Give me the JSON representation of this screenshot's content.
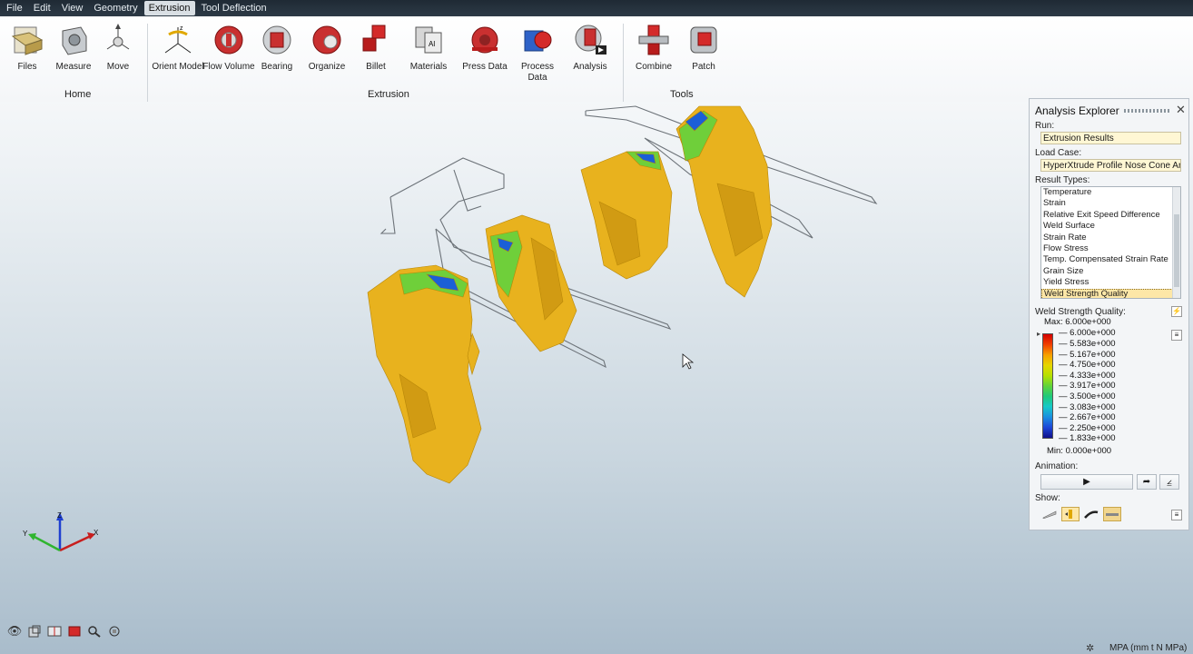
{
  "menu": {
    "items": [
      "File",
      "Edit",
      "View",
      "Geometry",
      "Extrusion",
      "Tool Deflection"
    ],
    "active_index": 4
  },
  "ribbon": {
    "buttons": [
      {
        "label": "Files",
        "icon": "folder-icon"
      },
      {
        "label": "Measure",
        "icon": "measure-icon"
      },
      {
        "label": "Move",
        "icon": "move-icon"
      },
      {
        "label": "Orient Model",
        "icon": "axes-icon"
      },
      {
        "label": "Flow Volume",
        "icon": "flow-volume-icon"
      },
      {
        "label": "Bearing",
        "icon": "bearing-icon"
      },
      {
        "label": "Organize",
        "icon": "organize-icon"
      },
      {
        "label": "Billet",
        "icon": "billet-icon"
      },
      {
        "label": "Materials",
        "icon": "materials-icon"
      },
      {
        "label": "Press Data",
        "icon": "press-icon"
      },
      {
        "label": "Process",
        "label2": "Data",
        "icon": "process-data-icon"
      },
      {
        "label": "Analysis",
        "icon": "analysis-icon"
      },
      {
        "label": "Combine",
        "icon": "combine-icon"
      },
      {
        "label": "Patch",
        "icon": "patch-icon"
      }
    ],
    "groups": [
      "Home",
      "Extrusion",
      "Tools"
    ]
  },
  "panel": {
    "title": "Analysis Explorer",
    "run_label": "Run:",
    "run_value": "Extrusion Results",
    "load_case_label": "Load Case:",
    "load_case_value": "HyperXtrude Profile Nose Cone An...",
    "result_types_label": "Result Types:",
    "result_types": [
      "Temperature",
      "Strain",
      "Relative Exit Speed Difference",
      "Weld Surface",
      "Strain Rate",
      "Flow Stress",
      "Temp. Compensated Strain Rate",
      "Grain Size",
      "Yield Stress",
      "Weld Strength Quality"
    ],
    "selected_result_index": 9,
    "legend_title": "Weld Strength Quality:",
    "legend_max_label": "Max:",
    "legend_max": "6.000e+000",
    "legend_values": [
      "6.000e+000",
      "5.583e+000",
      "5.167e+000",
      "4.750e+000",
      "4.333e+000",
      "3.917e+000",
      "3.500e+000",
      "3.083e+000",
      "2.667e+000",
      "2.250e+000",
      "1.833e+000"
    ],
    "legend_min_label": "Min:",
    "legend_min": "0.000e+000",
    "animation_label": "Animation:",
    "show_label": "Show:"
  },
  "status": {
    "units": "MPA (mm t N MPa)"
  },
  "triad": {
    "x": "X",
    "y": "Y",
    "z": "Z"
  },
  "colors": {
    "result_surface": "#e8b21e",
    "accent_selected": "#fde7a7",
    "icon_red": "#d42a2a"
  }
}
